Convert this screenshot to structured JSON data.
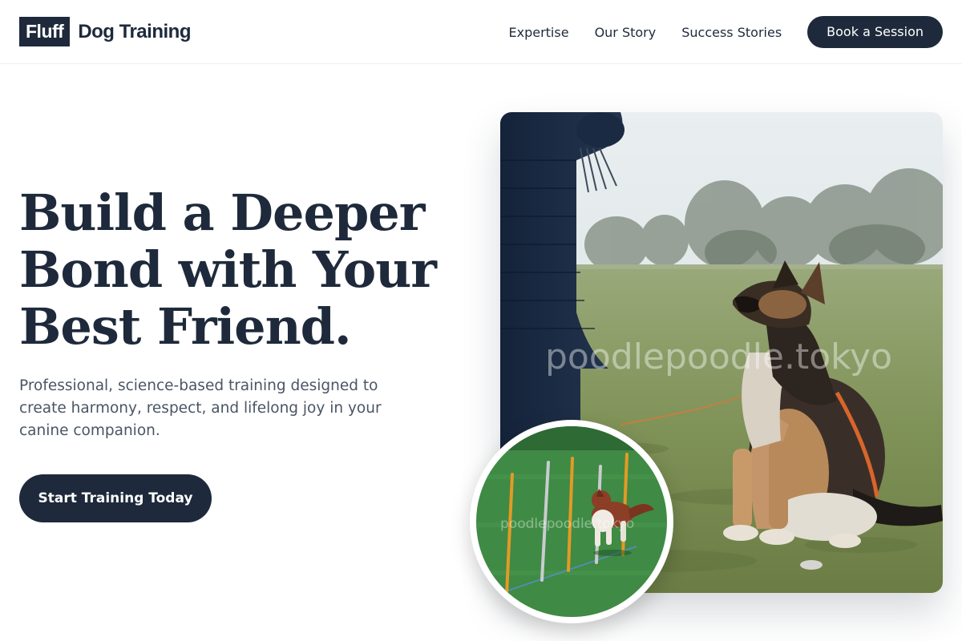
{
  "brand": {
    "mark": "Fluff",
    "name": "Dog Training"
  },
  "nav": {
    "links": [
      "Expertise",
      "Our Story",
      "Success Stories"
    ],
    "cta": "Book a Session"
  },
  "hero": {
    "title_lines": [
      "Build a Deeper",
      "Bond with Your",
      "Best Friend."
    ],
    "subtitle": "Professional, science-based training designed to create harmony, respect, and lifelong joy in your canine companion.",
    "cta": "Start Training Today"
  },
  "images": {
    "main": {
      "subject": "german-shepherd-sitting-in-park",
      "watermark": "poodlepoodle.tokyo"
    },
    "inset": {
      "subject": "border-collie-weave-poles-agility",
      "watermark": "poodlepoodle.tokyo"
    }
  },
  "colors": {
    "primary": "#1e2a3b",
    "text_muted": "#4a5565",
    "background": "#ffffff"
  }
}
